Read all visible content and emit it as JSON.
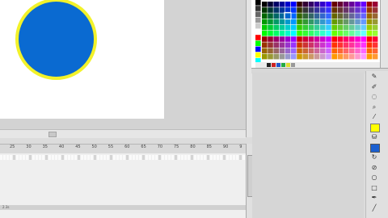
{
  "timeline": {
    "ticks": [
      "25",
      "30",
      "35",
      "40",
      "45",
      "50",
      "55",
      "60",
      "65",
      "70",
      "75",
      "80",
      "85",
      "90",
      "9"
    ],
    "status": "2.3s"
  },
  "colors": {
    "fill": "#0a6ad1",
    "stroke": "#f2f22a",
    "selected_fill": "#ffff00",
    "selected_stroke": "#1a5fd0"
  },
  "tools": [
    "pencil-icon",
    "brush-icon",
    "lasso-icon",
    "zoom-icon",
    "eyedropper-icon",
    "fill-color-swatch",
    "paint-bucket-icon",
    "stroke-color-swatch",
    "swap-colors-icon",
    "no-color-icon",
    "oval-icon",
    "rectangle-icon",
    "pen-icon",
    "line-icon"
  ]
}
